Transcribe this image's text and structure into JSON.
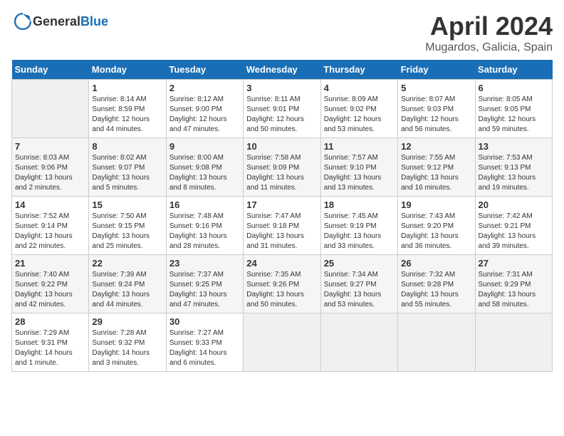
{
  "header": {
    "logo": {
      "text_general": "General",
      "text_blue": "Blue"
    },
    "title": "April 2024",
    "subtitle": "Mugardos, Galicia, Spain"
  },
  "calendar": {
    "days_of_week": [
      "Sunday",
      "Monday",
      "Tuesday",
      "Wednesday",
      "Thursday",
      "Friday",
      "Saturday"
    ],
    "weeks": [
      [
        {
          "day": "",
          "info": ""
        },
        {
          "day": "1",
          "info": "Sunrise: 8:14 AM\nSunset: 8:59 PM\nDaylight: 12 hours\nand 44 minutes."
        },
        {
          "day": "2",
          "info": "Sunrise: 8:12 AM\nSunset: 9:00 PM\nDaylight: 12 hours\nand 47 minutes."
        },
        {
          "day": "3",
          "info": "Sunrise: 8:11 AM\nSunset: 9:01 PM\nDaylight: 12 hours\nand 50 minutes."
        },
        {
          "day": "4",
          "info": "Sunrise: 8:09 AM\nSunset: 9:02 PM\nDaylight: 12 hours\nand 53 minutes."
        },
        {
          "day": "5",
          "info": "Sunrise: 8:07 AM\nSunset: 9:03 PM\nDaylight: 12 hours\nand 56 minutes."
        },
        {
          "day": "6",
          "info": "Sunrise: 8:05 AM\nSunset: 9:05 PM\nDaylight: 12 hours\nand 59 minutes."
        }
      ],
      [
        {
          "day": "7",
          "info": "Sunrise: 8:03 AM\nSunset: 9:06 PM\nDaylight: 13 hours\nand 2 minutes."
        },
        {
          "day": "8",
          "info": "Sunrise: 8:02 AM\nSunset: 9:07 PM\nDaylight: 13 hours\nand 5 minutes."
        },
        {
          "day": "9",
          "info": "Sunrise: 8:00 AM\nSunset: 9:08 PM\nDaylight: 13 hours\nand 8 minutes."
        },
        {
          "day": "10",
          "info": "Sunrise: 7:58 AM\nSunset: 9:09 PM\nDaylight: 13 hours\nand 11 minutes."
        },
        {
          "day": "11",
          "info": "Sunrise: 7:57 AM\nSunset: 9:10 PM\nDaylight: 13 hours\nand 13 minutes."
        },
        {
          "day": "12",
          "info": "Sunrise: 7:55 AM\nSunset: 9:12 PM\nDaylight: 13 hours\nand 16 minutes."
        },
        {
          "day": "13",
          "info": "Sunrise: 7:53 AM\nSunset: 9:13 PM\nDaylight: 13 hours\nand 19 minutes."
        }
      ],
      [
        {
          "day": "14",
          "info": "Sunrise: 7:52 AM\nSunset: 9:14 PM\nDaylight: 13 hours\nand 22 minutes."
        },
        {
          "day": "15",
          "info": "Sunrise: 7:50 AM\nSunset: 9:15 PM\nDaylight: 13 hours\nand 25 minutes."
        },
        {
          "day": "16",
          "info": "Sunrise: 7:48 AM\nSunset: 9:16 PM\nDaylight: 13 hours\nand 28 minutes."
        },
        {
          "day": "17",
          "info": "Sunrise: 7:47 AM\nSunset: 9:18 PM\nDaylight: 13 hours\nand 31 minutes."
        },
        {
          "day": "18",
          "info": "Sunrise: 7:45 AM\nSunset: 9:19 PM\nDaylight: 13 hours\nand 33 minutes."
        },
        {
          "day": "19",
          "info": "Sunrise: 7:43 AM\nSunset: 9:20 PM\nDaylight: 13 hours\nand 36 minutes."
        },
        {
          "day": "20",
          "info": "Sunrise: 7:42 AM\nSunset: 9:21 PM\nDaylight: 13 hours\nand 39 minutes."
        }
      ],
      [
        {
          "day": "21",
          "info": "Sunrise: 7:40 AM\nSunset: 9:22 PM\nDaylight: 13 hours\nand 42 minutes."
        },
        {
          "day": "22",
          "info": "Sunrise: 7:39 AM\nSunset: 9:24 PM\nDaylight: 13 hours\nand 44 minutes."
        },
        {
          "day": "23",
          "info": "Sunrise: 7:37 AM\nSunset: 9:25 PM\nDaylight: 13 hours\nand 47 minutes."
        },
        {
          "day": "24",
          "info": "Sunrise: 7:35 AM\nSunset: 9:26 PM\nDaylight: 13 hours\nand 50 minutes."
        },
        {
          "day": "25",
          "info": "Sunrise: 7:34 AM\nSunset: 9:27 PM\nDaylight: 13 hours\nand 53 minutes."
        },
        {
          "day": "26",
          "info": "Sunrise: 7:32 AM\nSunset: 9:28 PM\nDaylight: 13 hours\nand 55 minutes."
        },
        {
          "day": "27",
          "info": "Sunrise: 7:31 AM\nSunset: 9:29 PM\nDaylight: 13 hours\nand 58 minutes."
        }
      ],
      [
        {
          "day": "28",
          "info": "Sunrise: 7:29 AM\nSunset: 9:31 PM\nDaylight: 14 hours\nand 1 minute."
        },
        {
          "day": "29",
          "info": "Sunrise: 7:28 AM\nSunset: 9:32 PM\nDaylight: 14 hours\nand 3 minutes."
        },
        {
          "day": "30",
          "info": "Sunrise: 7:27 AM\nSunset: 9:33 PM\nDaylight: 14 hours\nand 6 minutes."
        },
        {
          "day": "",
          "info": ""
        },
        {
          "day": "",
          "info": ""
        },
        {
          "day": "",
          "info": ""
        },
        {
          "day": "",
          "info": ""
        }
      ]
    ]
  }
}
